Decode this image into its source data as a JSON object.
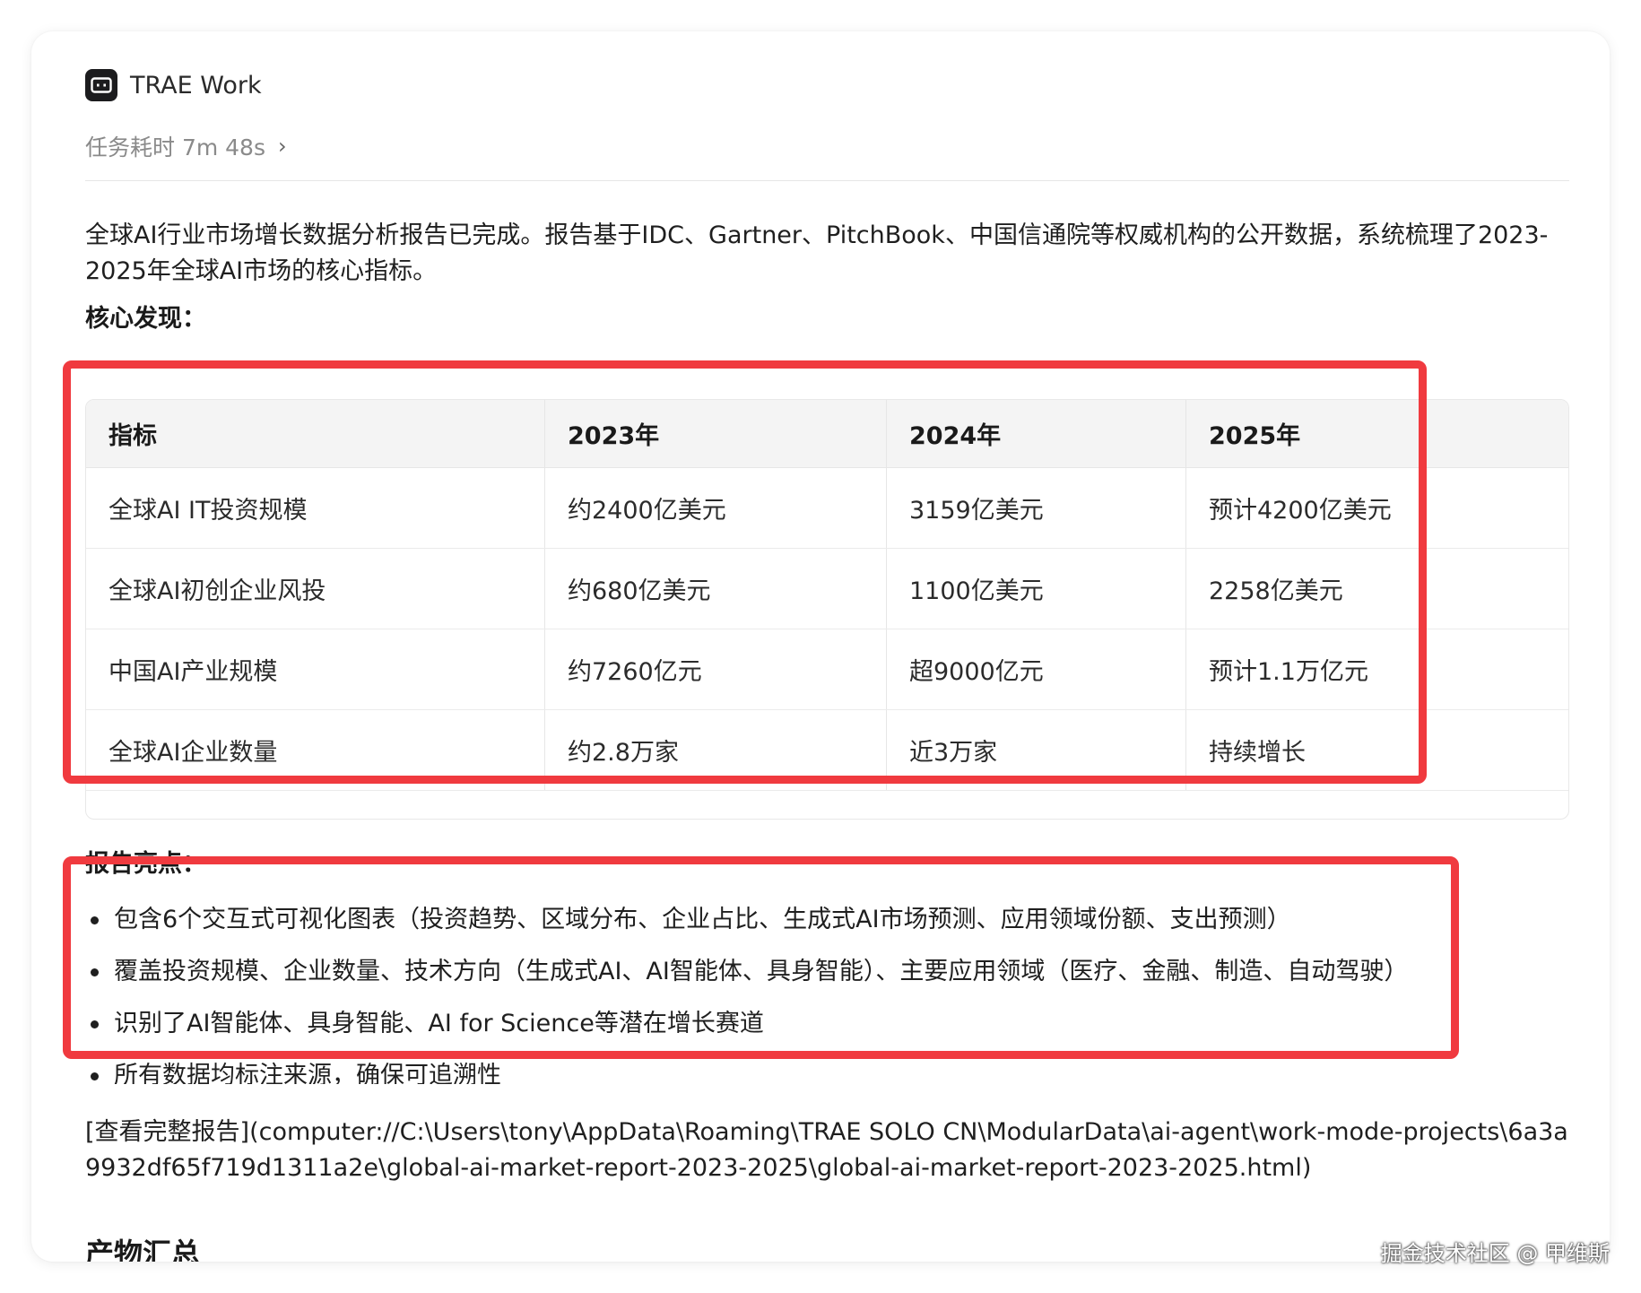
{
  "app": {
    "name": "TRAE Work"
  },
  "task": {
    "duration_label": "任务耗时 7m 48s"
  },
  "intro": "全球AI行业市场增长数据分析报告已完成。报告基于IDC、Gartner、PitchBook、中国信通院等权威机构的公开数据，系统梳理了2023-2025年全球AI市场的核心指标。",
  "findings": {
    "title": "核心发现：",
    "headers": [
      "指标",
      "2023年",
      "2024年",
      "2025年"
    ],
    "rows": [
      [
        "全球AI IT投资规模",
        "约2400亿美元",
        "3159亿美元",
        "预计4200亿美元"
      ],
      [
        "全球AI初创企业风投",
        "约680亿美元",
        "1100亿美元",
        "2258亿美元"
      ],
      [
        "中国AI产业规模",
        "约7260亿元",
        "超9000亿元",
        "预计1.1万亿元"
      ],
      [
        "全球AI企业数量",
        "约2.8万家",
        "近3万家",
        "持续增长"
      ]
    ]
  },
  "highlights": {
    "title": "报告亮点：",
    "items": [
      "包含6个交互式可视化图表（投资趋势、区域分布、企业占比、生成式AI市场预测、应用领域份额、支出预测）",
      "覆盖投资规模、企业数量、技术方向（生成式AI、AI智能体、具身智能）、主要应用领域（医疗、金融、制造、自动驾驶）",
      "识别了AI智能体、具身智能、AI for Science等潜在增长赛道",
      "所有数据均标注来源，确保可追溯性"
    ]
  },
  "report_link": "[查看完整报告](computer://C:\\Users\\tony\\AppData\\Roaming\\TRAE SOLO CN\\ModularData\\ai-agent\\work-mode-projects\\6a3a9932df65f719d1311a2e\\global-ai-market-report-2023-2025\\global-ai-market-report-2023-2025.html)",
  "outputs": {
    "title": "产物汇总"
  },
  "watermark": "掘金技术社区 @ 甲维斯",
  "colors": {
    "highlight": "#f03a3f",
    "app_icon_bg": "#1c1c1e"
  },
  "icons": {
    "app": "terminal-icon",
    "expand": "chevron-right-icon"
  }
}
